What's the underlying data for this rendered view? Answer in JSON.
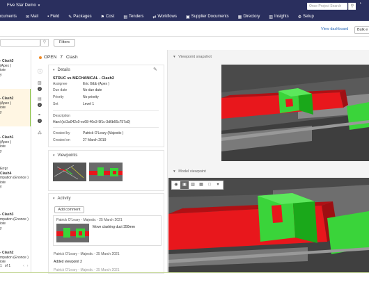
{
  "topbar": {
    "project_name": "Five Star Demo",
    "project_search_placeholder": "Once Project Search",
    "nav": [
      {
        "icon": "documents-icon",
        "label": "ocuments"
      },
      {
        "icon": "mail-icon",
        "label": "Mail"
      },
      {
        "icon": "field-icon",
        "label": "Field"
      },
      {
        "icon": "packages-icon",
        "label": "Packages"
      },
      {
        "icon": "cost-icon",
        "label": "Cost"
      },
      {
        "icon": "tenders-icon",
        "label": "Tenders"
      },
      {
        "icon": "workflows-icon",
        "label": "Workflows"
      },
      {
        "icon": "supplier-documents-icon",
        "label": "Supplier Documents"
      },
      {
        "icon": "directory-icon",
        "label": "Directory"
      },
      {
        "icon": "insights-icon",
        "label": "Insights"
      },
      {
        "icon": "setup-icon",
        "label": "Setup"
      }
    ]
  },
  "subhead": {
    "view_dashboard": "View dashboard",
    "bulk_button": "Bulk e"
  },
  "list": {
    "filters_label": "Filters",
    "items": [
      {
        "title": "- Clash3",
        "lines": [
          "(Apex )",
          "iote",
          "y"
        ],
        "selected": false
      },
      {
        "title": "- Clash2",
        "lines": [
          "(Apex )",
          "iote",
          "y"
        ],
        "selected": true
      },
      {
        "title": "- Clash1",
        "lines": [
          "(Apex )",
          "iote",
          "y"
        ],
        "selected": false
      },
      {
        "title": "Errgr",
        "lines": [
          "Clash4",
          "mpation (Enonce )",
          "iote",
          "y"
        ],
        "selected": false
      },
      {
        "title": "- Clash3",
        "lines": [
          "mpation (Enonce )",
          "iote",
          "y"
        ],
        "selected": false
      },
      {
        "title": "- Clash2",
        "lines": [
          "mpation (Enonce )",
          "iote"
        ],
        "selected": false
      }
    ],
    "pager": {
      "page": "1",
      "of": "of 1"
    }
  },
  "clash": {
    "status": "OPEN",
    "number": "7",
    "name": "Clash"
  },
  "details": {
    "header": "Details",
    "title": "STRUC vs MECHANICAL - Clash2",
    "rows": [
      {
        "label": "Assignee",
        "value": "Eric Gibb (Apex )"
      },
      {
        "label": "Due date",
        "value": "No due date"
      },
      {
        "label": "Priority",
        "value": "No priority"
      },
      {
        "label": "Set",
        "value": "Level 1"
      }
    ],
    "description_label": "Description",
    "description": "Hard (id:3a042c0-ec68-46e3-9f1c-3d6b66c757a0)",
    "created_by_label": "Created by",
    "created_by": "Patrick O'Leary (Majestic )",
    "created_on_label": "Created on",
    "created_on": "27 March 2019"
  },
  "viewpoints": {
    "header": "Viewpoints"
  },
  "activity": {
    "header": "Activity",
    "add_comment": "Add comment",
    "comment_author": "Patrick O'Leary - Majestic - 25 March 2021",
    "comment_text": "Move clashing duct 350mm",
    "entry2_author": "Patrick O'Leary - Majestic - 25 March 2021",
    "entry2_text": "Added viewpoint 2",
    "entry3_author": "Patrick O'Leary - Majestic - 25 March 2021"
  },
  "right": {
    "snapshot_header": "Viewpoint snapshot",
    "model_header": "Model viewpoint"
  },
  "colors": {
    "nav_bg": "#2a2f5e",
    "status_dot": "#f08a24",
    "selected_bar": "#8cc63e",
    "link": "#2a6ab8",
    "clash_red": "#e8171c",
    "clash_green": "#3ad43a"
  }
}
